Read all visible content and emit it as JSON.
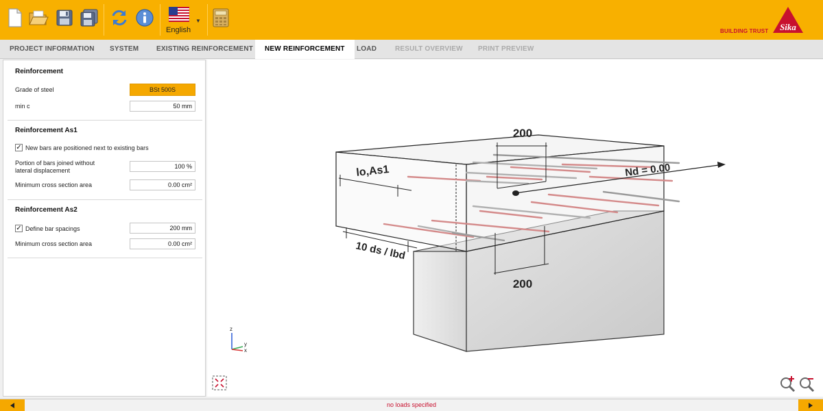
{
  "toolbar": {
    "buttons": [
      {
        "name": "new-file-icon"
      },
      {
        "name": "open-folder-icon"
      },
      {
        "name": "save-icon"
      },
      {
        "name": "save-as-icon"
      },
      {
        "name": "refresh-icon"
      },
      {
        "name": "info-icon"
      }
    ],
    "language": "English",
    "brand_tagline": "BUILDING TRUST",
    "logo_text": "Sika",
    "accent_color": "#f8b000",
    "brand_red": "#c8102e"
  },
  "tabs": [
    {
      "label": "PROJECT INFORMATION",
      "state": "normal"
    },
    {
      "label": "SYSTEM",
      "state": "normal"
    },
    {
      "label": "EXISTING REINFORCEMENT",
      "state": "normal"
    },
    {
      "label": "NEW REINFORCEMENT",
      "state": "active"
    },
    {
      "label": "LOAD",
      "state": "normal"
    },
    {
      "label": "RESULT OVERVIEW",
      "state": "disabled"
    },
    {
      "label": "PRINT PREVIEW",
      "state": "disabled"
    }
  ],
  "panel": {
    "reinforcement": {
      "title": "Reinforcement",
      "grade_label": "Grade of steel",
      "grade_value": "BSt 500S",
      "minc_label": "min c",
      "minc_value": "50 mm"
    },
    "as1": {
      "title": "Reinforcement As1",
      "checkbox_label": "New bars are positioned next to existing bars",
      "checked": true,
      "portion_label_1": "Portion of bars joined without",
      "portion_label_2": "lateral displacement",
      "portion_value": "100 %",
      "min_area_label": "Minimum cross section area",
      "min_area_value": "0.00 cm²"
    },
    "as2": {
      "title": "Reinforcement As2",
      "checkbox_label": "Define bar spacings",
      "checked": true,
      "spacing_value": "200 mm",
      "min_area_label": "Minimum cross section area",
      "min_area_value": "0.00 cm²"
    }
  },
  "model": {
    "dim_top": "200",
    "dim_bottom": "200",
    "lap_label": "lo,As1",
    "anchor_label": "10 ds / lbd",
    "force_label": "Nd = 0.00",
    "axis_z": "z",
    "axis_y": "y",
    "axis_x": "x"
  },
  "status": {
    "message": "no loads specified"
  }
}
